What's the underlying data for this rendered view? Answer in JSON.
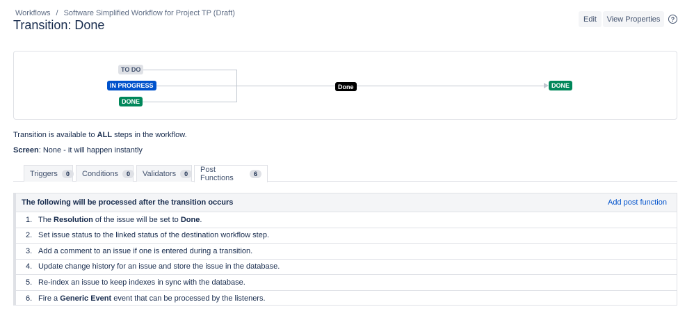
{
  "breadcrumb": {
    "root": "Workflows",
    "separator": "/",
    "current": "Software Simplified Workflow for Project TP (Draft)"
  },
  "title": "Transition: Done",
  "actions": {
    "edit": "Edit",
    "view_properties": "View Properties",
    "help": "?"
  },
  "diagram": {
    "sources": [
      "TO DO",
      "IN PROGRESS",
      "DONE"
    ],
    "transition": "Done",
    "target": "DONE",
    "colors": {
      "todo": "#dfe1e6",
      "inprogress": "#0052cc",
      "done": "#00875a",
      "transition": "#000000"
    }
  },
  "info": {
    "pre": "Transition is available to ",
    "bold": "ALL",
    "post": " steps in the workflow.",
    "screen_label": "Screen",
    "screen_value": ": None - it will happen instantly"
  },
  "tabs": [
    {
      "label": "Triggers",
      "count": "0"
    },
    {
      "label": "Conditions",
      "count": "0"
    },
    {
      "label": "Validators",
      "count": "0"
    },
    {
      "label": "Post Functions",
      "count": "6"
    }
  ],
  "post_functions": {
    "header": "The following will be processed after the transition occurs",
    "add_link": "Add post function",
    "items": [
      {
        "num": "1.",
        "parts": [
          [
            "The ",
            false
          ],
          [
            "Resolution",
            true
          ],
          [
            " of the issue will be set to ",
            false
          ],
          [
            "Done",
            true
          ],
          [
            ".",
            false
          ]
        ]
      },
      {
        "num": "2.",
        "parts": [
          [
            "Set issue status to the linked status of the destination workflow step.",
            false
          ]
        ]
      },
      {
        "num": "3.",
        "parts": [
          [
            "Add a comment to an issue if one is entered during a transition.",
            false
          ]
        ]
      },
      {
        "num": "4.",
        "parts": [
          [
            "Update change history for an issue and store the issue in the database.",
            false
          ]
        ]
      },
      {
        "num": "5.",
        "parts": [
          [
            "Re-index an issue to keep indexes in sync with the database.",
            false
          ]
        ]
      },
      {
        "num": "6.",
        "parts": [
          [
            "Fire a ",
            false
          ],
          [
            "Generic Event",
            true
          ],
          [
            " event that can be processed by the listeners.",
            false
          ]
        ]
      }
    ]
  }
}
